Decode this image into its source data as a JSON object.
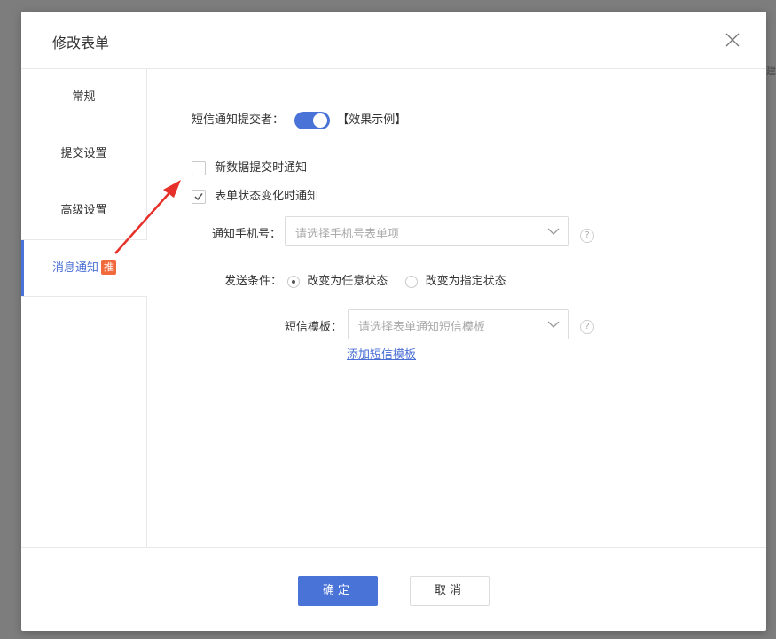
{
  "dialog": {
    "title": "修改表单"
  },
  "sidebar": {
    "items": [
      {
        "label": "常规"
      },
      {
        "label": "提交设置"
      },
      {
        "label": "高级设置"
      },
      {
        "label": "消息通知",
        "badge": "推"
      }
    ]
  },
  "sms_notify": {
    "label": "短信通知提交者：",
    "enabled": true,
    "example_link": "【效果示例】"
  },
  "options": {
    "new_data_label": "新数据提交时通知",
    "new_data_checked": false,
    "status_change_label": "表单状态变化时通知",
    "status_change_checked": true
  },
  "phone_field": {
    "label": "通知手机号：",
    "placeholder": "请选择手机号表单项"
  },
  "send_condition": {
    "label": "发送条件：",
    "options": [
      {
        "label": "改变为任意状态",
        "selected": true
      },
      {
        "label": "改变为指定状态",
        "selected": false
      }
    ]
  },
  "sms_template": {
    "label": "短信模板：",
    "placeholder": "请选择表单通知短信模板",
    "add_link": "添加短信模板"
  },
  "footer": {
    "confirm_label": "确定",
    "cancel_label": "取消"
  },
  "colors": {
    "accent": "#4a73d8",
    "badge": "#f06a3c",
    "arrow": "#e8302a"
  },
  "background": {
    "right_header_text": "创建"
  }
}
